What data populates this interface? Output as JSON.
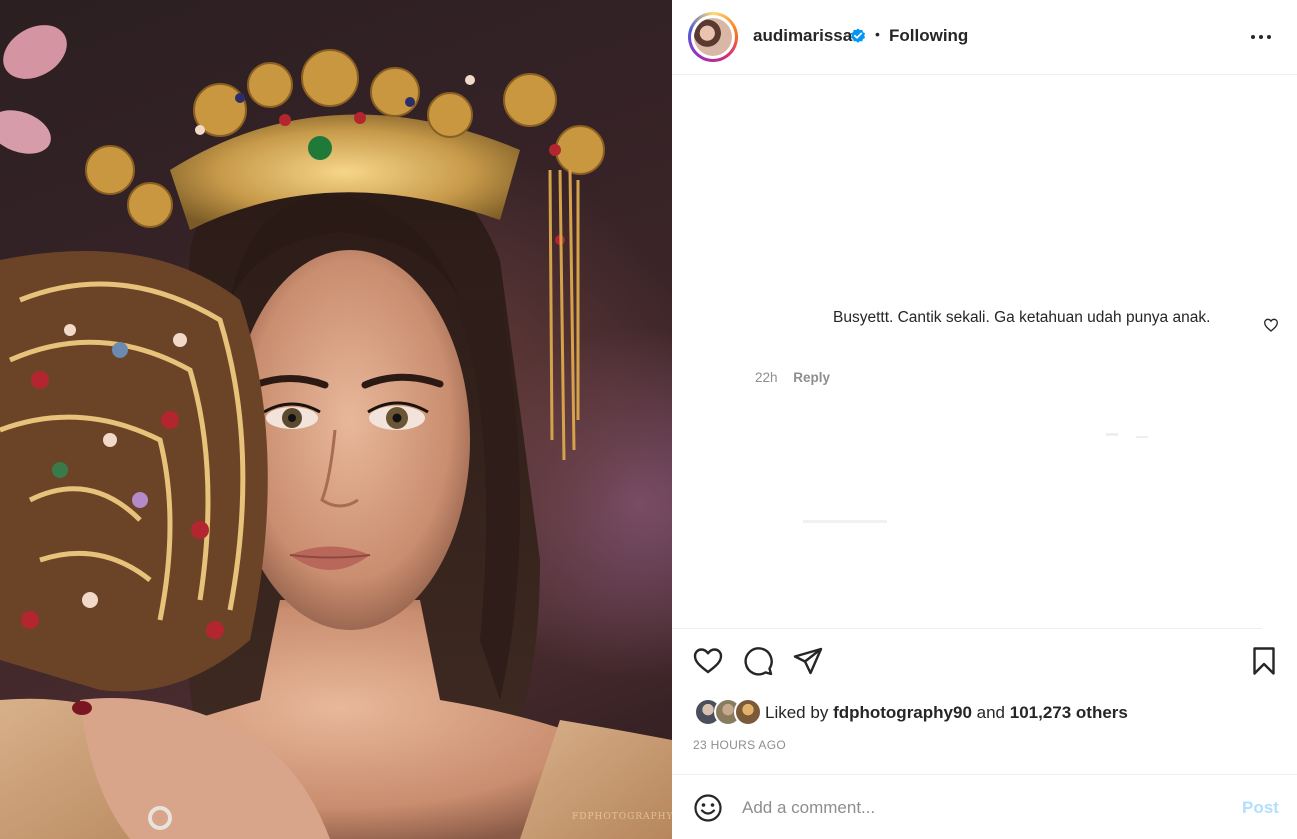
{
  "post": {
    "image_alt": "Portrait of woman with golden crown and ornamental fan",
    "watermark": "FDPHOTOGRAPHY"
  },
  "header": {
    "username": "audimarissa",
    "separator": "•",
    "follow_status": "Following",
    "verified": true
  },
  "comments": [
    {
      "text": "Busyettt. Cantik sekali. Ga ketahuan udah punya anak.",
      "time": "22h",
      "reply_label": "Reply"
    }
  ],
  "likes": {
    "prefix": "Liked by",
    "first_user": "fdphotography90",
    "joiner": "and",
    "others": "101,273 others"
  },
  "posted_ago": "23 HOURS AGO",
  "comment_box": {
    "placeholder": "Add a comment...",
    "post_label": "Post"
  },
  "colors": {
    "text": "#262626",
    "secondary": "#8e8e8e",
    "verified_blue": "#0095f6",
    "post_disabled": "#b2dffc"
  },
  "icons": [
    "verified-badge-icon",
    "more-options-icon",
    "heart-icon",
    "comment-icon",
    "share-icon",
    "bookmark-icon",
    "emoji-icon"
  ]
}
